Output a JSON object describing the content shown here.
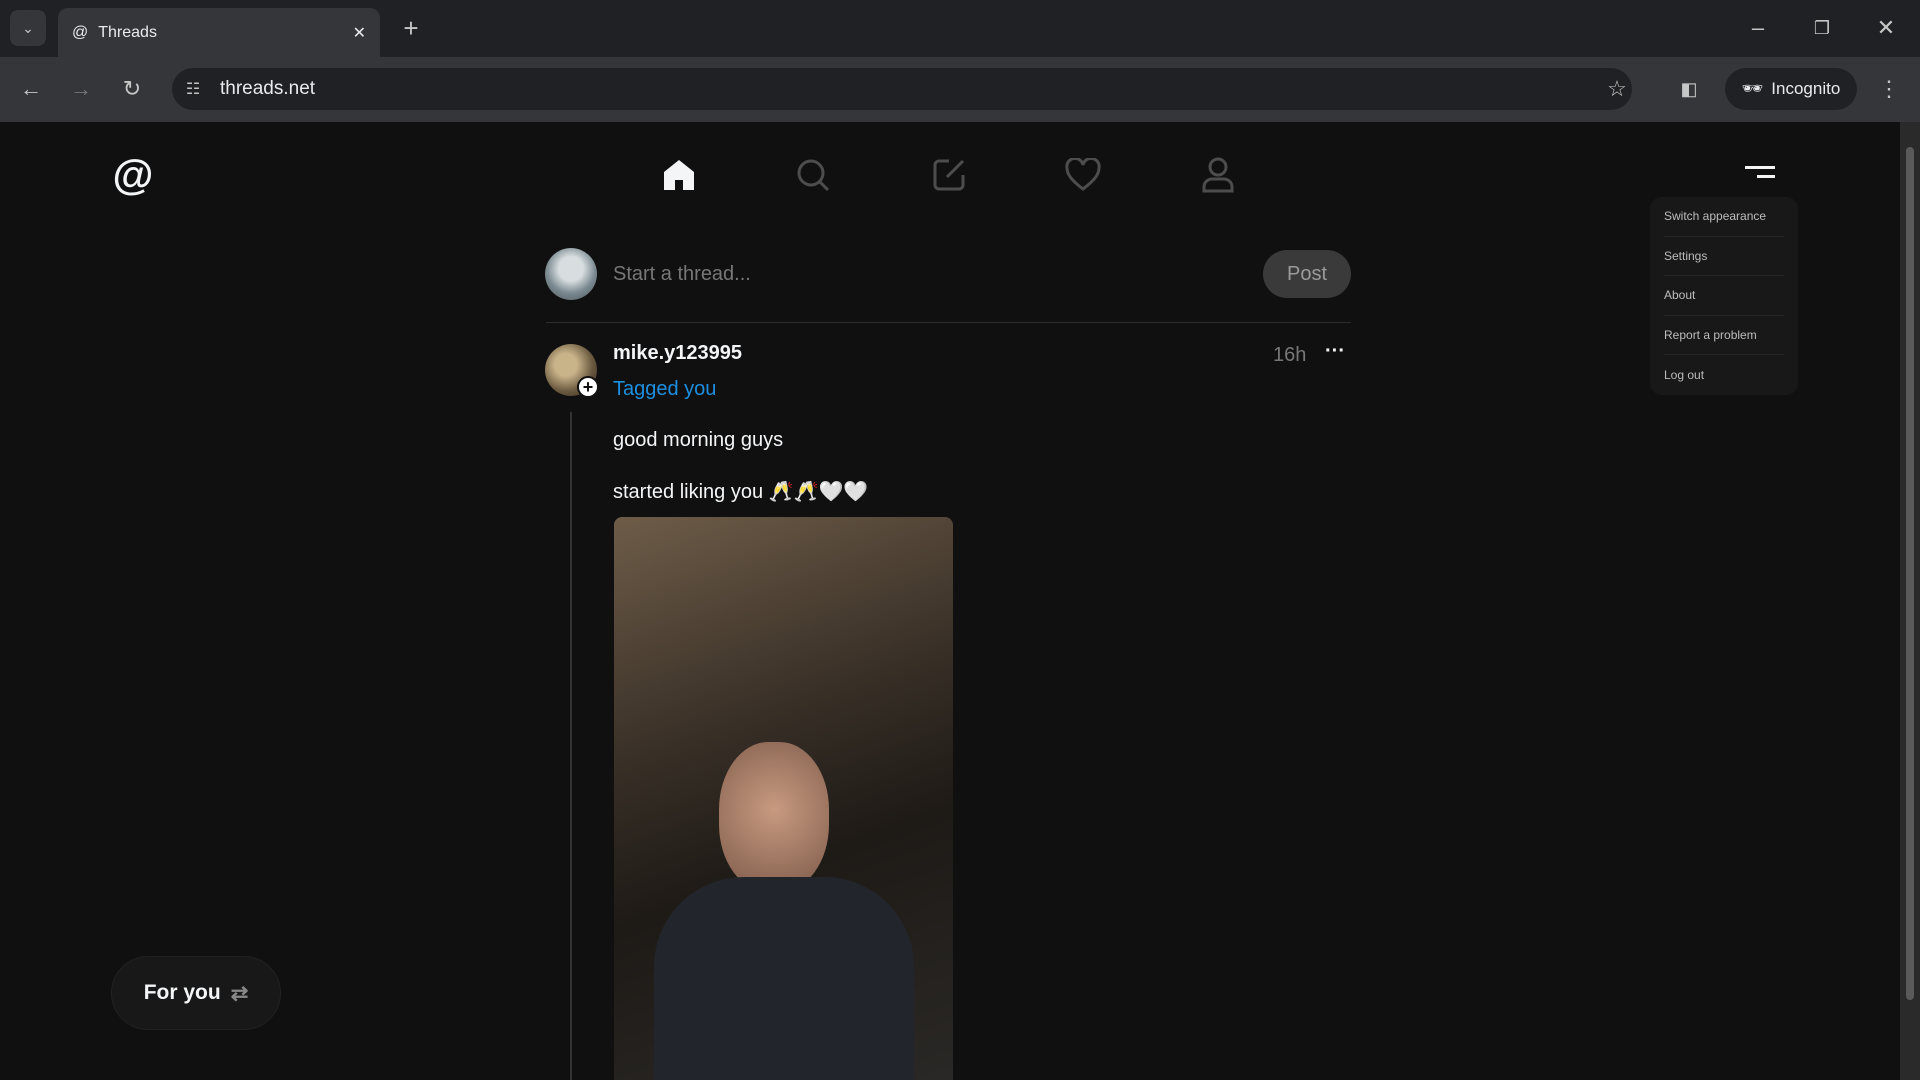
{
  "browser": {
    "tab_title": "Threads",
    "url": "threads.net",
    "incognito_label": "Incognito"
  },
  "nav": {
    "items": [
      "home",
      "search",
      "create",
      "activity",
      "profile"
    ]
  },
  "compose": {
    "placeholder": "Start a thread...",
    "post_label": "Post"
  },
  "post": {
    "username": "mike.y123995",
    "tag": "Tagged you",
    "time": "16h",
    "lines": [
      "good morning guys",
      "started liking you 🥂🥂🤍🤍"
    ]
  },
  "menu": {
    "items": [
      "Switch appearance",
      "Settings",
      "About",
      "Report a problem",
      "Log out"
    ]
  },
  "feed_switch": {
    "label": "For you"
  },
  "colors": {
    "tag_blue": "#1d8fe1",
    "background": "#101010"
  }
}
